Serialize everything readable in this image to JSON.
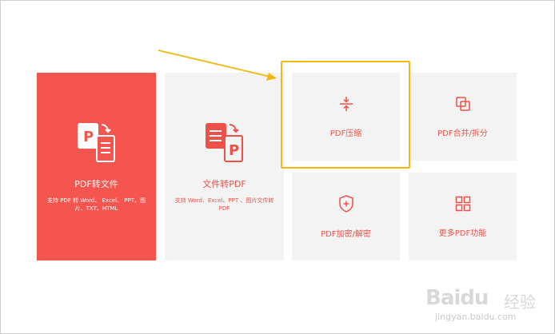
{
  "cards": {
    "pdf_to_file": {
      "title": "PDF转文件",
      "desc": "支持 PDF 转 Word、 Excel、 PPT、图片、TXT、HTML",
      "icon": "pdf-to-file-icon"
    },
    "file_to_pdf": {
      "title": "文件转PDF",
      "desc": "支持 Word、Excel、PPT 、图片文件转 PDF",
      "icon": "file-to-pdf-icon"
    },
    "compress": {
      "label": "PDF压缩",
      "icon": "compress-icon"
    },
    "merge_split": {
      "label": "PDF合并/拆分",
      "icon": "merge-split-icon"
    },
    "encrypt": {
      "label": "PDF加密/解密",
      "icon": "shield-plus-icon"
    },
    "more": {
      "label": "更多PDF功能",
      "icon": "grid-icon"
    }
  },
  "watermark": {
    "logo_text": "Baidu",
    "logo_text2": "经验",
    "url": "jingyan.baidu.com"
  },
  "colors": {
    "accent": "#f5554f",
    "label_red": "#ef5148",
    "card_gray": "#f3f3f3",
    "highlight": "#f3b80f"
  }
}
